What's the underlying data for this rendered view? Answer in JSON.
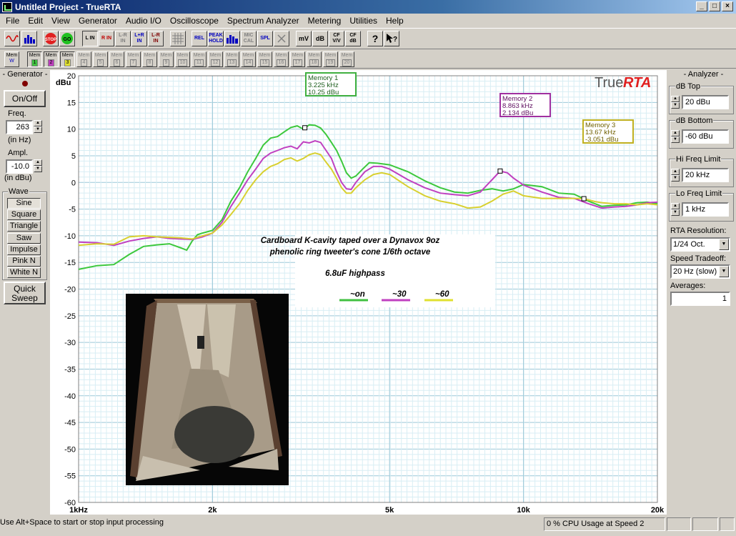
{
  "window": {
    "title": "Untitled Project - TrueRTA",
    "min": "_",
    "max": "□",
    "close": "×"
  },
  "menu": [
    "File",
    "Edit",
    "View",
    "Generator",
    "Audio I/O",
    "Oscilloscope",
    "Spectrum Analyzer",
    "Metering",
    "Utilities",
    "Help"
  ],
  "toolbar": {
    "in_buttons": [
      "L IN",
      "R IN",
      "L-R IN",
      "L+R IN",
      "L-R IN"
    ],
    "rel": "REL",
    "peak_hold": "PEAK HOLD",
    "mic_cal": "MIC CAL",
    "spl": "SPL",
    "mv": "mV",
    "db": "dB",
    "cf_vv": "CF V/V",
    "cf_db": "CF dB",
    "stop": "STOP",
    "go": "GO",
    "help": "?"
  },
  "memory_bar": {
    "label": "Mem",
    "w": "W",
    "slots": [
      "1",
      "2",
      "3",
      "4",
      "5",
      "6",
      "7",
      "8",
      "9",
      "10",
      "11",
      "12",
      "13",
      "14",
      "15",
      "16",
      "17",
      "18",
      "19",
      "20"
    ]
  },
  "generator": {
    "title": "- Generator -",
    "onoff": "On/Off",
    "freq_label": "Freq.",
    "freq_value": "263",
    "freq_unit": "(in Hz)",
    "ampl_label": "Ampl.",
    "ampl_value": "-10.0",
    "ampl_unit": "(in dBu)",
    "wave_label": "Wave",
    "waves": [
      "Sine",
      "Square",
      "Triangle",
      "Saw",
      "Impulse",
      "Pink N",
      "White N"
    ],
    "quick": "Quick",
    "sweep": "Sweep"
  },
  "analyzer": {
    "title": "- Analyzer -",
    "db_top_label": "dB Top",
    "db_top": "20 dBu",
    "db_bottom_label": "dB Bottom",
    "db_bottom": "-60 dBu",
    "hi_freq_label": "Hi Freq Limit",
    "hi_freq": "20 kHz",
    "lo_freq_label": "Lo Freq Limit",
    "lo_freq": "1 kHz",
    "rta_res_label": "RTA Resolution:",
    "rta_res": "1/24 Oct.",
    "speed_label": "Speed Tradeoff:",
    "speed": "20 Hz (slow)",
    "averages_label": "Averages:",
    "averages": "1"
  },
  "annotations": {
    "brand_true": "True",
    "brand_rta": "RTA",
    "note_line1": "Cardboard K-cavity taped over a Dynavox 9oz",
    "note_line2": "phenolic ring tweeter's cone 1/6th octave",
    "note_line3": "6.8uF highpass",
    "legend": [
      {
        "label": "~on",
        "color": "#40c040"
      },
      {
        "label": "~30",
        "color": "#c040c0"
      },
      {
        "label": "~60",
        "color": "#e0e030"
      }
    ],
    "markers": [
      {
        "name": "Memory 1",
        "freq": "3.225 kHz",
        "level": "10.25 dBu",
        "color": "#40b040"
      },
      {
        "name": "Memory 2",
        "freq": "8.863 kHz",
        "level": "2.134 dBu",
        "color": "#a030a0"
      },
      {
        "name": "Memory 3",
        "freq": "13.67 kHz",
        "level": "-3.051 dBu",
        "color": "#c0b020"
      }
    ]
  },
  "chart_data": {
    "type": "line",
    "ylabel": "dBu",
    "ylim": [
      -60,
      20
    ],
    "y_ticks": [
      "20",
      "15",
      "10",
      "5",
      "0",
      "-5",
      "-10",
      "-15",
      "-20",
      "-25",
      "-30",
      "-35",
      "-40",
      "-45",
      "-50",
      "-55",
      "-60"
    ],
    "xlim_hz": [
      1000,
      20000
    ],
    "x_scale": "log",
    "x_tick_labels": [
      {
        "hz": 1000,
        "label": "1kHz"
      },
      {
        "hz": 2000,
        "label": "2k"
      },
      {
        "hz": 5000,
        "label": "5k"
      },
      {
        "hz": 10000,
        "label": "10k"
      },
      {
        "hz": 20000,
        "label": "20k"
      }
    ],
    "series": [
      {
        "name": "~on",
        "color": "#3cc83c",
        "points": [
          [
            1000,
            -16.3
          ],
          [
            1100,
            -15.6
          ],
          [
            1200,
            -15.4
          ],
          [
            1300,
            -13.5
          ],
          [
            1400,
            -12.0
          ],
          [
            1500,
            -11.7
          ],
          [
            1600,
            -11.5
          ],
          [
            1700,
            -12.3
          ],
          [
            1750,
            -12.7
          ],
          [
            1800,
            -11.0
          ],
          [
            1850,
            -9.8
          ],
          [
            1900,
            -9.5
          ],
          [
            2000,
            -9.0
          ],
          [
            2100,
            -7.0
          ],
          [
            2200,
            -3.5
          ],
          [
            2300,
            -1.0
          ],
          [
            2400,
            2.0
          ],
          [
            2500,
            4.5
          ],
          [
            2600,
            7.0
          ],
          [
            2700,
            8.3
          ],
          [
            2800,
            8.6
          ],
          [
            2900,
            9.5
          ],
          [
            3000,
            10.3
          ],
          [
            3100,
            10.6
          ],
          [
            3200,
            10.0
          ],
          [
            3300,
            10.8
          ],
          [
            3400,
            10.7
          ],
          [
            3500,
            10.2
          ],
          [
            3600,
            9.0
          ],
          [
            3700,
            7.5
          ],
          [
            3800,
            6.0
          ],
          [
            3900,
            4.0
          ],
          [
            4000,
            1.8
          ],
          [
            4100,
            0.8
          ],
          [
            4200,
            1.2
          ],
          [
            4350,
            2.5
          ],
          [
            4500,
            3.7
          ],
          [
            4700,
            3.6
          ],
          [
            5000,
            3.3
          ],
          [
            5500,
            2.0
          ],
          [
            6000,
            0.3
          ],
          [
            6500,
            -1.0
          ],
          [
            7000,
            -1.8
          ],
          [
            7500,
            -2.0
          ],
          [
            8000,
            -1.5
          ],
          [
            8500,
            -1.2
          ],
          [
            9000,
            -1.6
          ],
          [
            9500,
            -1.2
          ],
          [
            10000,
            -0.4
          ],
          [
            11000,
            -0.8
          ],
          [
            12000,
            -2.0
          ],
          [
            13000,
            -2.2
          ],
          [
            14000,
            -3.5
          ],
          [
            15000,
            -4.5
          ],
          [
            16000,
            -4.3
          ],
          [
            17000,
            -4.2
          ],
          [
            18000,
            -3.8
          ],
          [
            19000,
            -3.7
          ],
          [
            20000,
            -4.0
          ]
        ]
      },
      {
        "name": "~30",
        "color": "#c040c0",
        "points": [
          [
            1000,
            -11.2
          ],
          [
            1100,
            -11.3
          ],
          [
            1200,
            -11.8
          ],
          [
            1300,
            -11.0
          ],
          [
            1400,
            -10.5
          ],
          [
            1500,
            -10.2
          ],
          [
            1600,
            -10.5
          ],
          [
            1700,
            -10.6
          ],
          [
            1800,
            -10.7
          ],
          [
            1900,
            -10.2
          ],
          [
            2000,
            -9.5
          ],
          [
            2100,
            -7.5
          ],
          [
            2200,
            -4.5
          ],
          [
            2300,
            -2.0
          ],
          [
            2400,
            0.5
          ],
          [
            2500,
            2.5
          ],
          [
            2600,
            4.5
          ],
          [
            2700,
            5.5
          ],
          [
            2800,
            6.0
          ],
          [
            2900,
            6.5
          ],
          [
            3000,
            6.8
          ],
          [
            3100,
            6.3
          ],
          [
            3200,
            7.6
          ],
          [
            3300,
            7.4
          ],
          [
            3400,
            7.8
          ],
          [
            3500,
            7.5
          ],
          [
            3600,
            6.0
          ],
          [
            3700,
            4.5
          ],
          [
            3800,
            2.0
          ],
          [
            3900,
            0.0
          ],
          [
            4000,
            -1.2
          ],
          [
            4100,
            -1.3
          ],
          [
            4200,
            0.0
          ],
          [
            4400,
            2.0
          ],
          [
            4600,
            3.0
          ],
          [
            4800,
            3.0
          ],
          [
            5000,
            2.5
          ],
          [
            5500,
            0.5
          ],
          [
            6000,
            -1.0
          ],
          [
            6500,
            -2.0
          ],
          [
            7000,
            -2.3
          ],
          [
            7500,
            -2.5
          ],
          [
            8000,
            -1.8
          ],
          [
            8500,
            0.5
          ],
          [
            8863,
            2.13
          ],
          [
            9200,
            1.8
          ],
          [
            9500,
            0.8
          ],
          [
            10000,
            -0.5
          ],
          [
            11000,
            -1.8
          ],
          [
            12000,
            -2.8
          ],
          [
            13000,
            -3.0
          ],
          [
            14000,
            -4.0
          ],
          [
            15000,
            -4.8
          ],
          [
            16000,
            -4.6
          ],
          [
            17000,
            -4.5
          ],
          [
            18000,
            -4.2
          ],
          [
            19000,
            -3.8
          ],
          [
            20000,
            -3.7
          ]
        ]
      },
      {
        "name": "~60",
        "color": "#d8d030",
        "points": [
          [
            1000,
            -11.8
          ],
          [
            1100,
            -11.5
          ],
          [
            1200,
            -11.6
          ],
          [
            1300,
            -10.2
          ],
          [
            1400,
            -10.0
          ],
          [
            1500,
            -10.2
          ],
          [
            1600,
            -10.3
          ],
          [
            1700,
            -10.4
          ],
          [
            1800,
            -10.6
          ],
          [
            1900,
            -10.0
          ],
          [
            2000,
            -9.5
          ],
          [
            2100,
            -8.0
          ],
          [
            2200,
            -6.0
          ],
          [
            2300,
            -4.0
          ],
          [
            2400,
            -1.5
          ],
          [
            2500,
            0.5
          ],
          [
            2600,
            2.0
          ],
          [
            2700,
            3.0
          ],
          [
            2800,
            3.5
          ],
          [
            2900,
            4.3
          ],
          [
            3000,
            4.6
          ],
          [
            3100,
            4.0
          ],
          [
            3200,
            4.5
          ],
          [
            3300,
            5.2
          ],
          [
            3400,
            5.5
          ],
          [
            3500,
            5.2
          ],
          [
            3600,
            3.8
          ],
          [
            3700,
            2.5
          ],
          [
            3800,
            0.8
          ],
          [
            3900,
            -1.0
          ],
          [
            4000,
            -2.0
          ],
          [
            4100,
            -2.0
          ],
          [
            4200,
            -1.0
          ],
          [
            4400,
            0.5
          ],
          [
            4600,
            1.5
          ],
          [
            4800,
            1.8
          ],
          [
            5000,
            1.5
          ],
          [
            5500,
            -0.8
          ],
          [
            6000,
            -2.5
          ],
          [
            6500,
            -3.5
          ],
          [
            7000,
            -4.0
          ],
          [
            7500,
            -4.8
          ],
          [
            8000,
            -4.6
          ],
          [
            8500,
            -3.5
          ],
          [
            9000,
            -2.2
          ],
          [
            9500,
            -1.6
          ],
          [
            10000,
            -2.5
          ],
          [
            11000,
            -3.0
          ],
          [
            12000,
            -3.0
          ],
          [
            13000,
            -3.0
          ],
          [
            13670,
            -3.05
          ],
          [
            14500,
            -3.6
          ],
          [
            15000,
            -3.8
          ],
          [
            16000,
            -4.0
          ],
          [
            17000,
            -4.0
          ],
          [
            18000,
            -4.2
          ],
          [
            19000,
            -4.0
          ],
          [
            20000,
            -4.2
          ]
        ]
      }
    ]
  },
  "status": {
    "hint": "Use Alt+Space to start or stop input processing",
    "cpu": "0 % CPU Usage at Speed 2"
  }
}
